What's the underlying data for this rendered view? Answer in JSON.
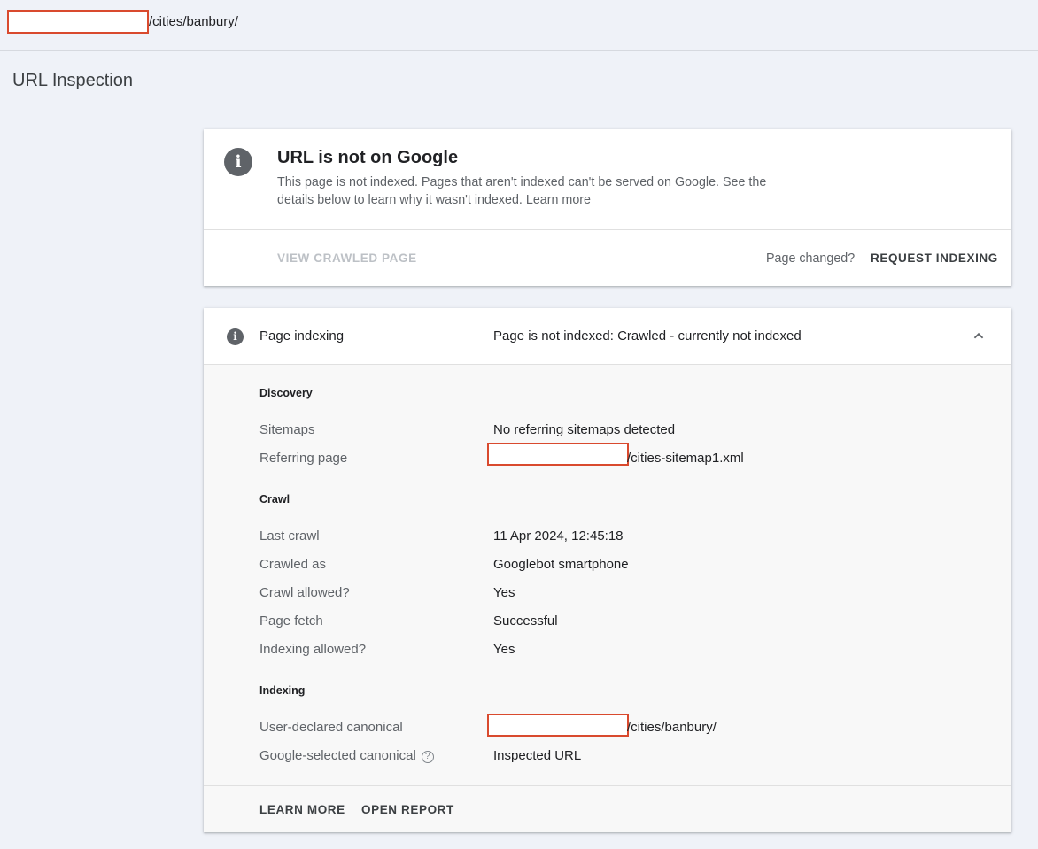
{
  "topbar": {
    "url_suffix": "/cities/banbury/"
  },
  "page": {
    "title": "URL Inspection"
  },
  "status_card": {
    "headline": "URL is not on Google",
    "description": "This page is not indexed. Pages that aren't indexed can't be served on Google. See the details below to learn why it wasn't indexed.",
    "learn_more": "Learn more",
    "view_crawled": "VIEW CRAWLED PAGE",
    "page_changed": "Page changed?",
    "request_indexing": "REQUEST INDEXING"
  },
  "indexing_card": {
    "label": "Page indexing",
    "status": "Page is not indexed: Crawled - currently not indexed",
    "discovery": {
      "title": "Discovery",
      "sitemaps_label": "Sitemaps",
      "sitemaps_value": "No referring sitemaps detected",
      "referring_label": "Referring page",
      "referring_value_suffix": "/cities-sitemap1.xml"
    },
    "crawl": {
      "title": "Crawl",
      "last_crawl_label": "Last crawl",
      "last_crawl_value": "11 Apr 2024, 12:45:18",
      "crawled_as_label": "Crawled as",
      "crawled_as_value": "Googlebot smartphone",
      "crawl_allowed_label": "Crawl allowed?",
      "crawl_allowed_value": "Yes",
      "page_fetch_label": "Page fetch",
      "page_fetch_value": "Successful",
      "indexing_allowed_label": "Indexing allowed?",
      "indexing_allowed_value": "Yes"
    },
    "indexing": {
      "title": "Indexing",
      "user_canonical_label": "User-declared canonical",
      "user_canonical_value_suffix": "/cities/banbury/",
      "google_canonical_label": "Google-selected canonical",
      "google_canonical_value": "Inspected URL"
    },
    "footer": {
      "learn_more": "LEARN MORE",
      "open_report": "OPEN REPORT"
    }
  },
  "icons": {
    "info": "info-icon",
    "help": "help-icon",
    "collapse": "chevron-up-icon"
  },
  "colors": {
    "redaction_border": "#d94a2e",
    "background": "#eff2f8"
  }
}
